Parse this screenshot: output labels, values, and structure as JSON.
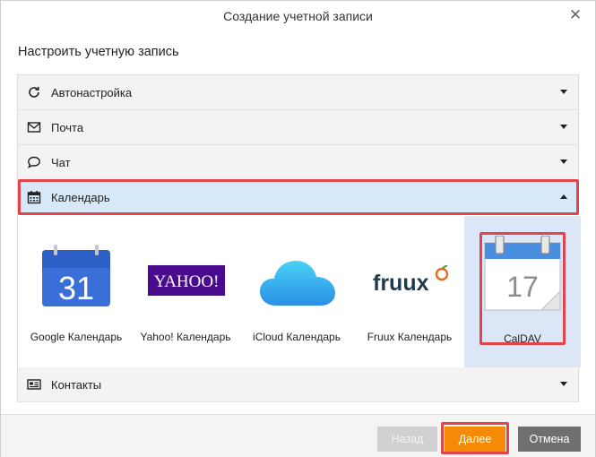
{
  "dialog": {
    "title": "Создание учетной записи",
    "subtitle": "Настроить учетную запись"
  },
  "accordion": {
    "sections": [
      {
        "label": "Автонастройка",
        "icon": "refresh-icon",
        "expanded": false
      },
      {
        "label": "Почта",
        "icon": "envelope-icon",
        "expanded": false
      },
      {
        "label": "Чат",
        "icon": "chat-bubble-icon",
        "expanded": false
      },
      {
        "label": "Календарь",
        "icon": "calendar-icon",
        "expanded": true
      },
      {
        "label": "Контакты",
        "icon": "contact-card-icon",
        "expanded": false
      }
    ]
  },
  "providers": [
    {
      "label": "Google Календарь",
      "icon": "google-calendar-icon",
      "icon_text": "31"
    },
    {
      "label": "Yahoo! Календарь",
      "icon": "yahoo-logo-icon",
      "icon_text": "YAHOO!"
    },
    {
      "label": "iCloud Календарь",
      "icon": "icloud-icon"
    },
    {
      "label": "Fruux Календарь",
      "icon": "fruux-logo-icon",
      "icon_text": "fruux"
    },
    {
      "label": "CalDAV",
      "icon": "caldav-calendar-icon",
      "icon_text": "17",
      "selected": true
    }
  ],
  "footer": {
    "back_label": "Назад",
    "next_label": "Далее",
    "cancel_label": "Отмена"
  },
  "colors": {
    "accent_orange": "#f58a07",
    "highlight_red": "#e2444e",
    "selected_row": "#d7e8f9",
    "selected_tile": "#dbe7f7"
  }
}
